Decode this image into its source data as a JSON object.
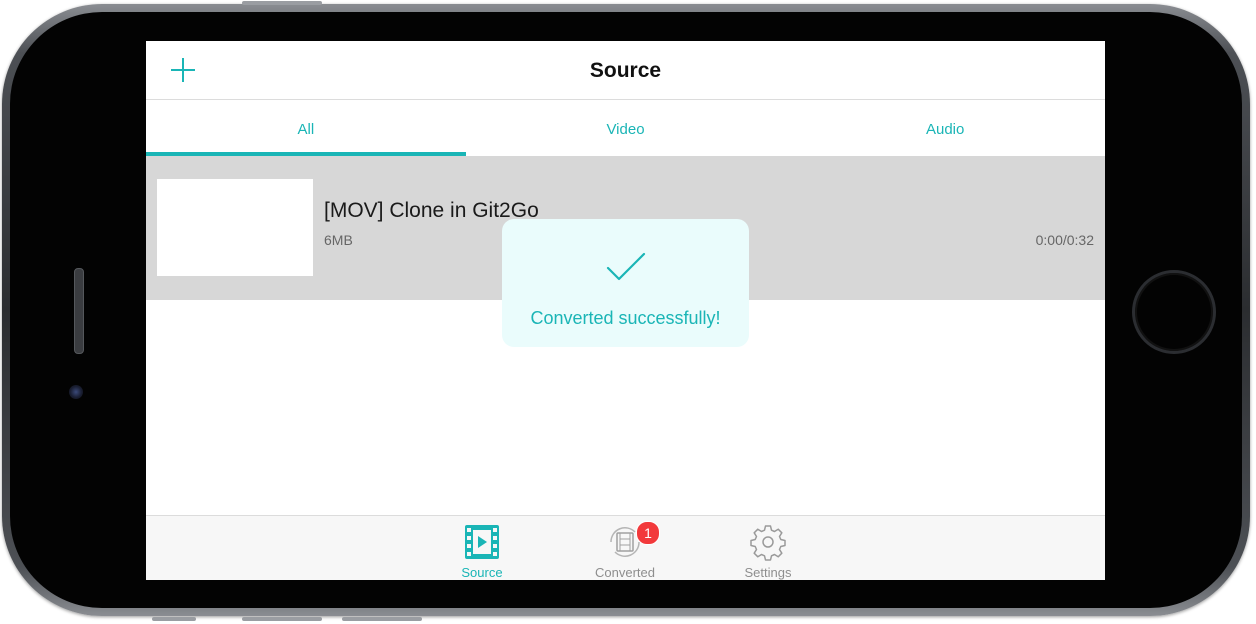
{
  "navbar": {
    "title": "Source",
    "add_icon": "plus-icon"
  },
  "tabs": [
    {
      "label": "All",
      "active": true
    },
    {
      "label": "Video",
      "active": false
    },
    {
      "label": "Audio",
      "active": false
    }
  ],
  "items": [
    {
      "title": "[MOV] Clone in Git2Go",
      "size": "6MB",
      "duration": "0:00/0:32"
    }
  ],
  "toast": {
    "message": "Converted successfully!",
    "icon": "checkmark-icon"
  },
  "tabbar": {
    "items": [
      {
        "label": "Source",
        "icon": "film-play-icon",
        "active": true
      },
      {
        "label": "Converted",
        "icon": "converted-film-icon",
        "active": false,
        "badge": "1"
      },
      {
        "label": "Settings",
        "icon": "gear-icon",
        "active": false
      }
    ]
  },
  "colors": {
    "accent": "#1ab5b6",
    "badge": "#f2393b",
    "row_background": "#d7d7d7",
    "toast_background": "#eafcfc"
  }
}
